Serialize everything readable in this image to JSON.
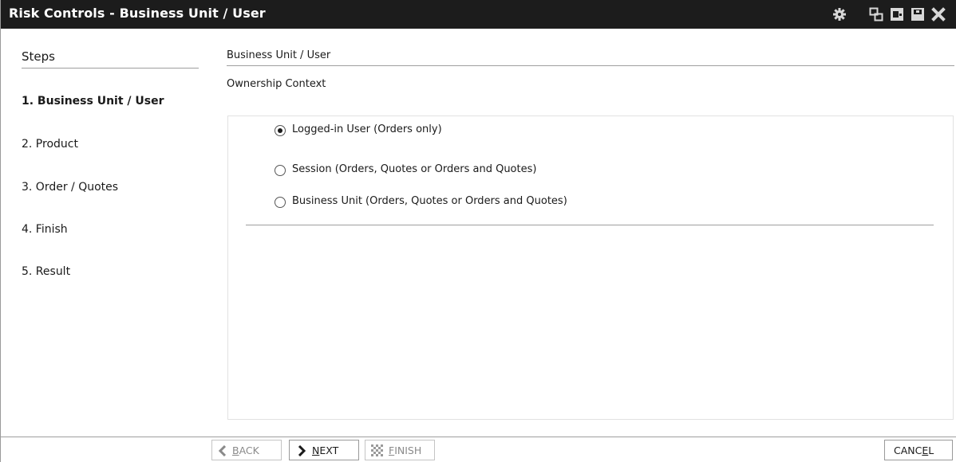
{
  "window": {
    "title": "Risk Controls - Business Unit / User",
    "icons": [
      "settings-gear-icon",
      "restore-window-icon",
      "detach-window-icon",
      "pin-window-icon",
      "close-icon"
    ]
  },
  "sidebar": {
    "header": "Steps",
    "steps": [
      {
        "label": "1. Business Unit / User",
        "active": true
      },
      {
        "label": "2. Product",
        "active": false
      },
      {
        "label": "3. Order / Quotes",
        "active": false
      },
      {
        "label": "4. Finish",
        "active": false
      },
      {
        "label": "5. Result",
        "active": false
      }
    ]
  },
  "main": {
    "title": "Business Unit / User",
    "section_label": "Ownership Context",
    "options": [
      {
        "label": "Logged-in User (Orders only)",
        "checked": true
      },
      {
        "label": "Session (Orders, Quotes or Orders and Quotes)",
        "checked": false
      },
      {
        "label": "Business Unit (Orders, Quotes or Orders and Quotes)",
        "checked": false
      }
    ]
  },
  "footer": {
    "back": {
      "accel": "B",
      "rest": "ACK",
      "enabled": false,
      "icon": "chevron-left-icon"
    },
    "next": {
      "accel": "N",
      "rest": "EXT",
      "enabled": true,
      "icon": "chevron-right-icon"
    },
    "finish": {
      "accel": "F",
      "rest": "INISH",
      "enabled": false,
      "icon": "checkered-flag-icon"
    },
    "cancel": {
      "pre": "CANC",
      "accel": "E",
      "post": "L",
      "enabled": true
    }
  }
}
